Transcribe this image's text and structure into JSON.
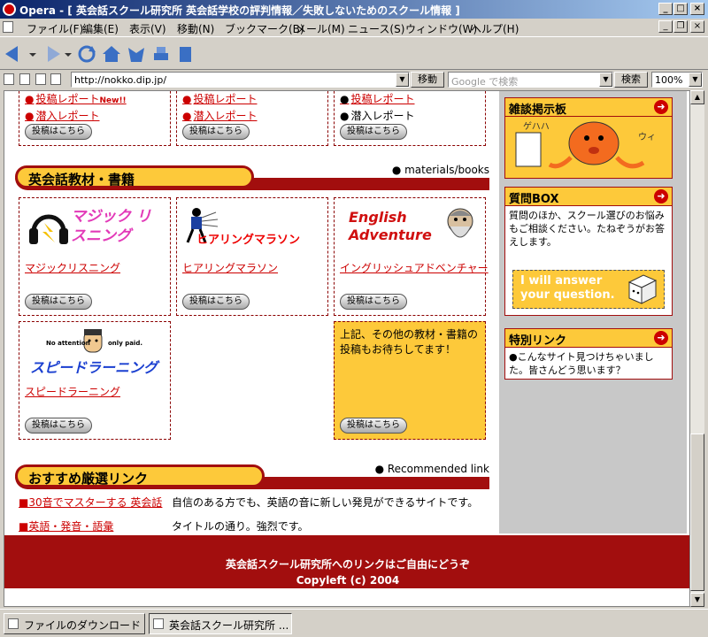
{
  "window": {
    "title": "Opera - [ 英会話スクール研究所 英会話学校の評判情報／失敗しないためのスクール情報 ]",
    "minimize": "_",
    "maximize": "□",
    "close": "×"
  },
  "menu": [
    "ファイル(F)",
    "編集(E)",
    "表示(V)",
    "移動(N)",
    "ブックマーク(B)",
    "メール(M)",
    "ニュース(S)",
    "ウィンドウ(W)",
    "ヘルプ(H)"
  ],
  "addressbar": {
    "url": "http://nokko.dip.jp/",
    "go_label": "移動",
    "search_placeholder": "Google で検索",
    "search_label": "検索",
    "zoom": "100%"
  },
  "top_cards": [
    {
      "item1": "投稿レポート",
      "new_badge": "New!!",
      "item2": "潜入レポート",
      "button": "投稿はこちら"
    },
    {
      "item1": "投稿レポート",
      "item2": "潜入レポート",
      "button": "投稿はこちら"
    },
    {
      "item1": "投稿レポート",
      "item2": "潜入レポート",
      "button": "投稿はこちら"
    }
  ],
  "materials": {
    "heading": "英会話教材・書籍",
    "subtitle": "● materials/books",
    "items": [
      {
        "logo": "マジック リスニング",
        "link": "マジックリスニング",
        "button": "投稿はこちら"
      },
      {
        "logo": "ヒアリングマラソン",
        "link": "ヒアリングマラソン",
        "button": "投稿はこちら"
      },
      {
        "logo_line1": "English",
        "logo_line2": "Adventure",
        "link": "イングリッシュアドベンチャー",
        "button": "投稿はこちら"
      },
      {
        "logo_small_left": "No attention",
        "logo_small_right": "only paid.",
        "logo": "スピードラーニング",
        "link": "スピードラーニング",
        "button": "投稿はこちら"
      }
    ],
    "other": {
      "text": "上記、その他の教材・書籍の投稿もお待ちしてます！",
      "button": "投稿はこちら"
    }
  },
  "recommended": {
    "heading": "おすすめ厳選リンク",
    "subtitle": "● Recommended link",
    "links": [
      {
        "title": "■30音でマスターする 英会話",
        "desc": "自信のある方でも、英語の音に新しい発見ができるサイトです。"
      },
      {
        "title": "■英語・発音・語彙",
        "desc": "タイトルの通り。強烈です。"
      }
    ]
  },
  "sidebar": {
    "board": {
      "title": "雑談掲示板",
      "img_text1": "ゲハハ",
      "img_text2": "ウィ"
    },
    "qa": {
      "title": "質問BOX",
      "text": "質問のほか、スクール選びのお悩みもご相談ください。たねぞうがお答えします。",
      "banner": "I will answer your question."
    },
    "special": {
      "title": "特別リンク",
      "text": "●こんなサイト見つけちゃいました。皆さんどう思います？"
    }
  },
  "footer": {
    "line1": "英会話スクール研究所へのリンクはご自由にどうぞ",
    "line2": "Copyleft (c) 2004"
  },
  "statusbar": {
    "tab1": "ファイルのダウンロード",
    "tab2": "英会話スクール研究所 ..."
  },
  "colors": {
    "accent_red": "#a20e0e",
    "accent_yellow": "#fdc93a",
    "link_red": "#cc0000"
  }
}
